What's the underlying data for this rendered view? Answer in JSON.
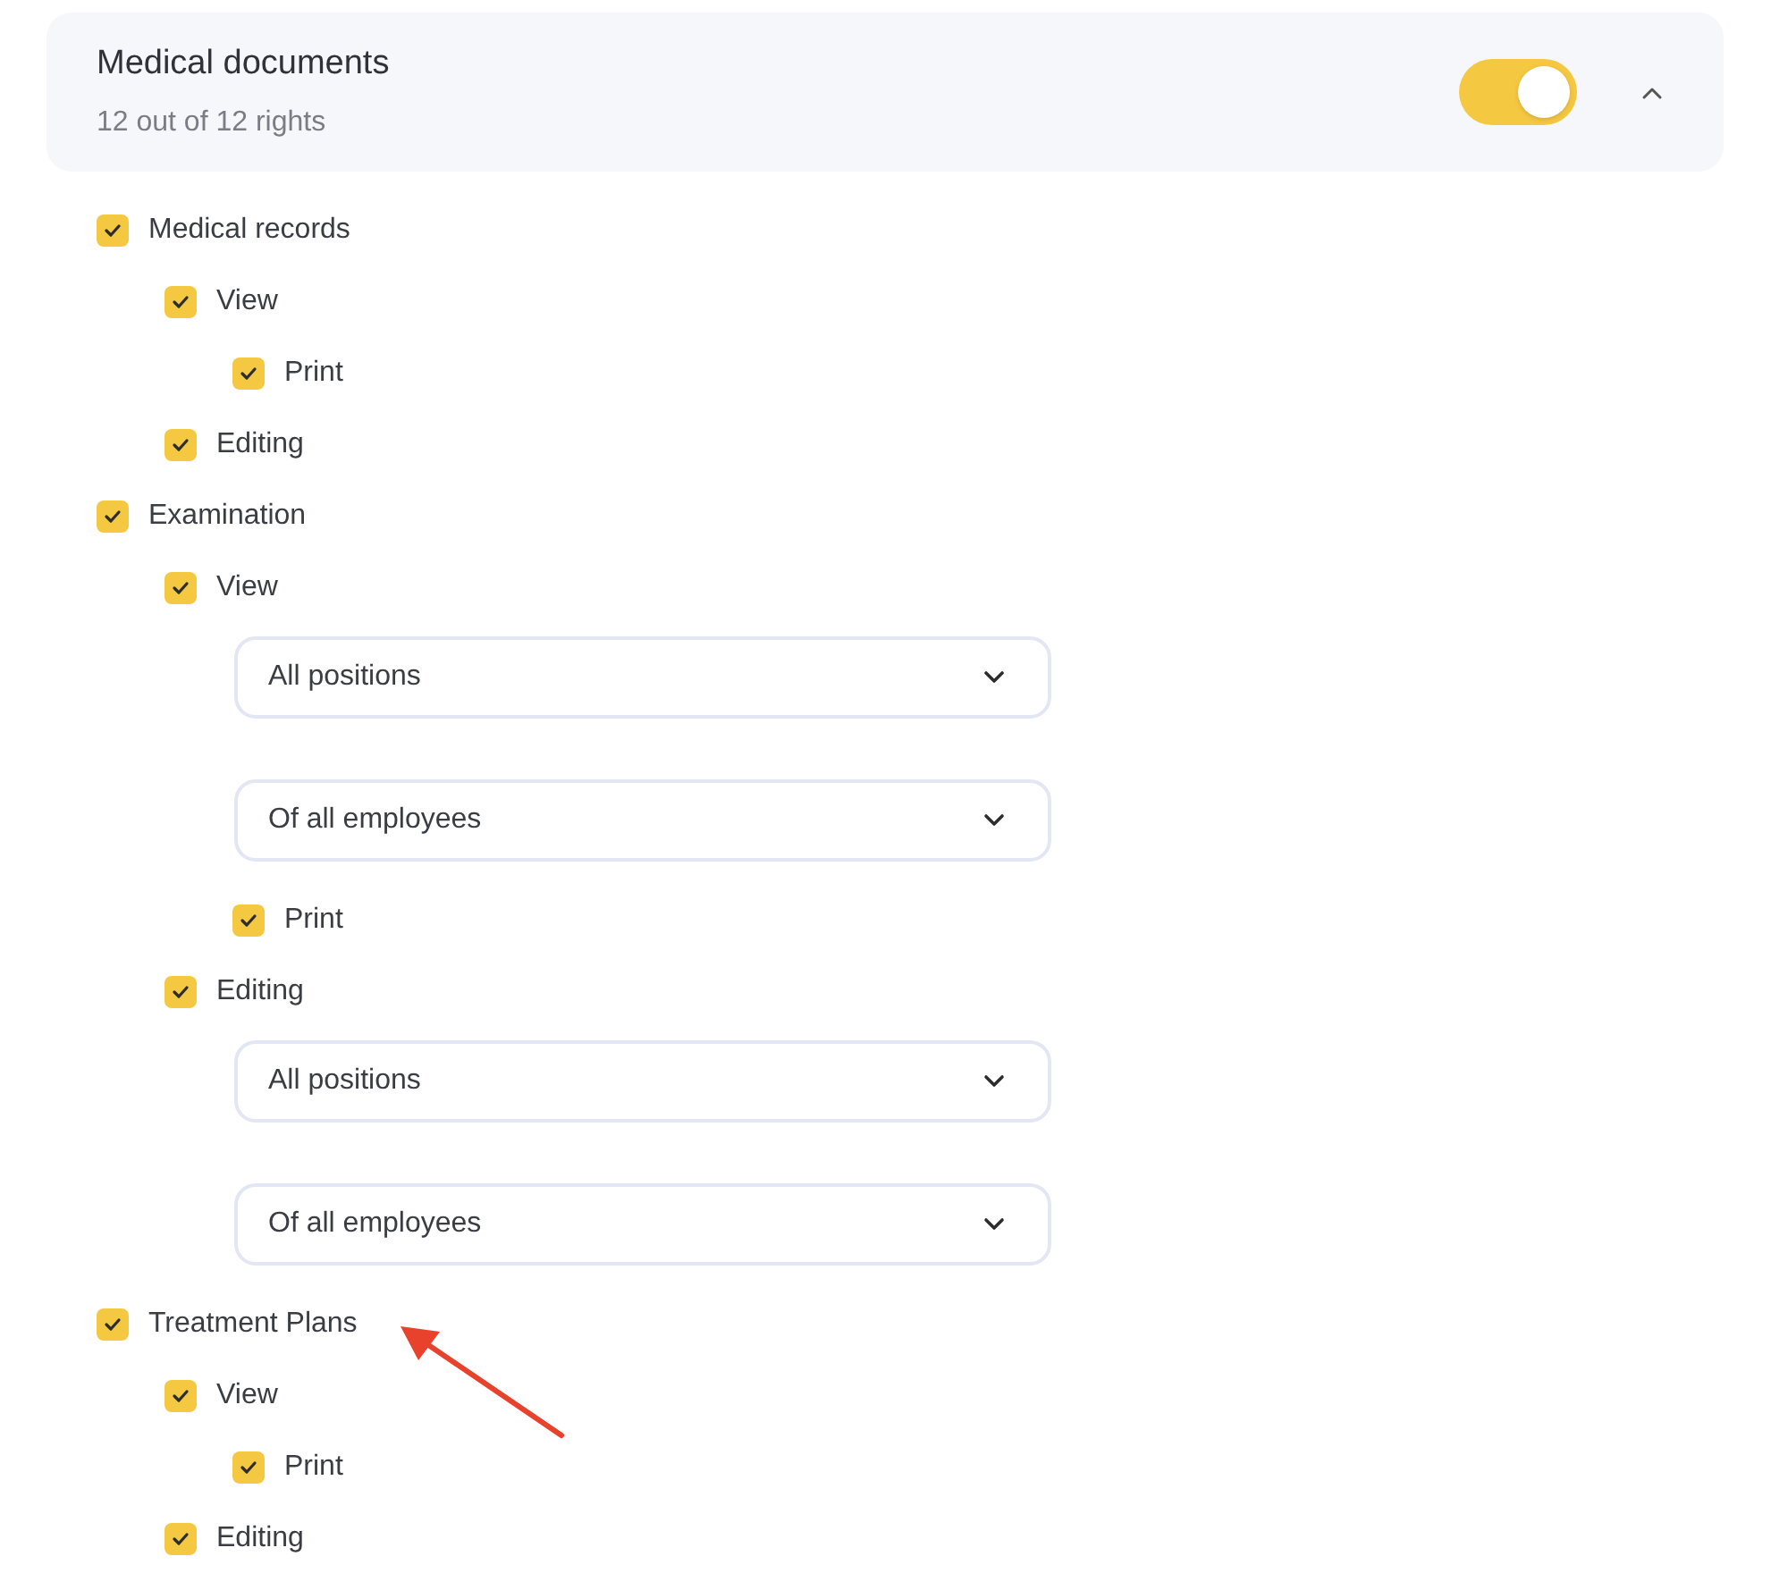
{
  "section": {
    "title": "Medical documents",
    "subtitle": "12 out of 12 rights",
    "on": true,
    "expanded": true
  },
  "items": [
    {
      "label": "Medical records",
      "checked": true,
      "children": [
        {
          "label": "View",
          "checked": true,
          "children": [
            {
              "label": "Print",
              "checked": true
            }
          ]
        },
        {
          "label": "Editing",
          "checked": true
        }
      ]
    },
    {
      "label": "Examination",
      "checked": true,
      "children": [
        {
          "label": "View",
          "checked": true,
          "selects": [
            {
              "value": "All positions"
            },
            {
              "value": "Of all employees"
            }
          ],
          "children": [
            {
              "label": "Print",
              "checked": true
            }
          ]
        },
        {
          "label": "Editing",
          "checked": true,
          "selects": [
            {
              "value": "All positions"
            },
            {
              "value": "Of all employees"
            }
          ]
        }
      ]
    },
    {
      "label": "Treatment Plans",
      "checked": true,
      "children": [
        {
          "label": "View",
          "checked": true,
          "children": [
            {
              "label": "Print",
              "checked": true
            }
          ]
        },
        {
          "label": "Editing",
          "checked": true
        }
      ]
    }
  ]
}
